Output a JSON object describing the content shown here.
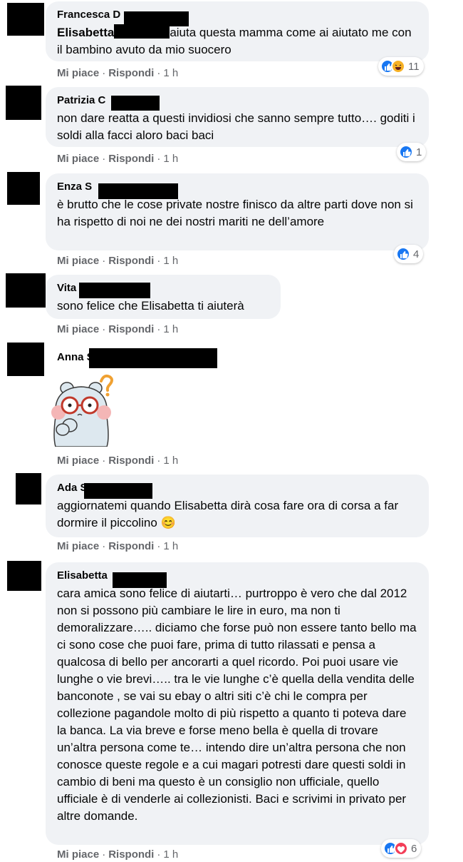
{
  "actions": {
    "like": "Mi piace",
    "reply": "Rispondi",
    "time": "1 h",
    "sep": "·"
  },
  "comments": [
    {
      "author": "Francesca D",
      "mention": "Elisabetta",
      "text": "aiuta questa mamma come ai aiutato me con il bambino avuto da mio suocero",
      "reactions": [
        "like",
        "haha"
      ],
      "count": "11"
    },
    {
      "author": "Patrizia C",
      "text": "non dare reatta a questi invidiosi che sanno sempre tutto…. goditi i soldi alla facci aloro baci baci",
      "reactions": [
        "like"
      ],
      "count": "1"
    },
    {
      "author": "Enza S",
      "text": "è brutto che le cose private nostre finisco da altre parti dove non si ha rispetto di noi ne dei nostri mariti ne dell’amore",
      "reactions": [
        "like"
      ],
      "count": "4"
    },
    {
      "author": "Vita",
      "text": "sono felice che Elisabetta ti aiuterà"
    },
    {
      "author": "Anna S",
      "sticker": "confused-bear-sticker"
    },
    {
      "author": "Ada S",
      "text": "aggiornatemi quando Elisabetta dirà cosa fare ora di corsa a far dormire il piccolino 😊"
    },
    {
      "author": "Elisabetta",
      "text": "cara amica sono felice di aiutarti… purtroppo è vero che dal 2012 non si possono più cambiare le lire in euro, ma non ti demoralizzare….. diciamo che forse può non essere tanto bello ma ci sono cose che puoi fare, prima di tutto rilassati e pensa a qualcosa di bello per ancorarti a quel ricordo. Poi puoi usare vie lunghe o vie brevi….. tra le vie lunghe c’è quella della vendita delle banconote , se vai su ebay o altri siti c’è chi le compra per collezione pagandole molto di più rispetto a quanto ti poteva dare la banca. La via breve e forse meno bella è quella di trovare un’altra persona come te… intendo dire un’altra persona che non conosce queste regole e a cui magari potresti dare questi soldi in cambio di beni ma questo è un consiglio non ufficiale, quello ufficiale è di venderle ai collezionisti. Baci e scrivimi in privato per altre domande.",
      "reactions": [
        "like",
        "love"
      ],
      "count": "6"
    }
  ],
  "colors": {
    "bubble": "#f0f2f5",
    "meta": "#65676b",
    "like": "#1877f2",
    "haha": "#f7b125",
    "love": "#f33e58"
  }
}
